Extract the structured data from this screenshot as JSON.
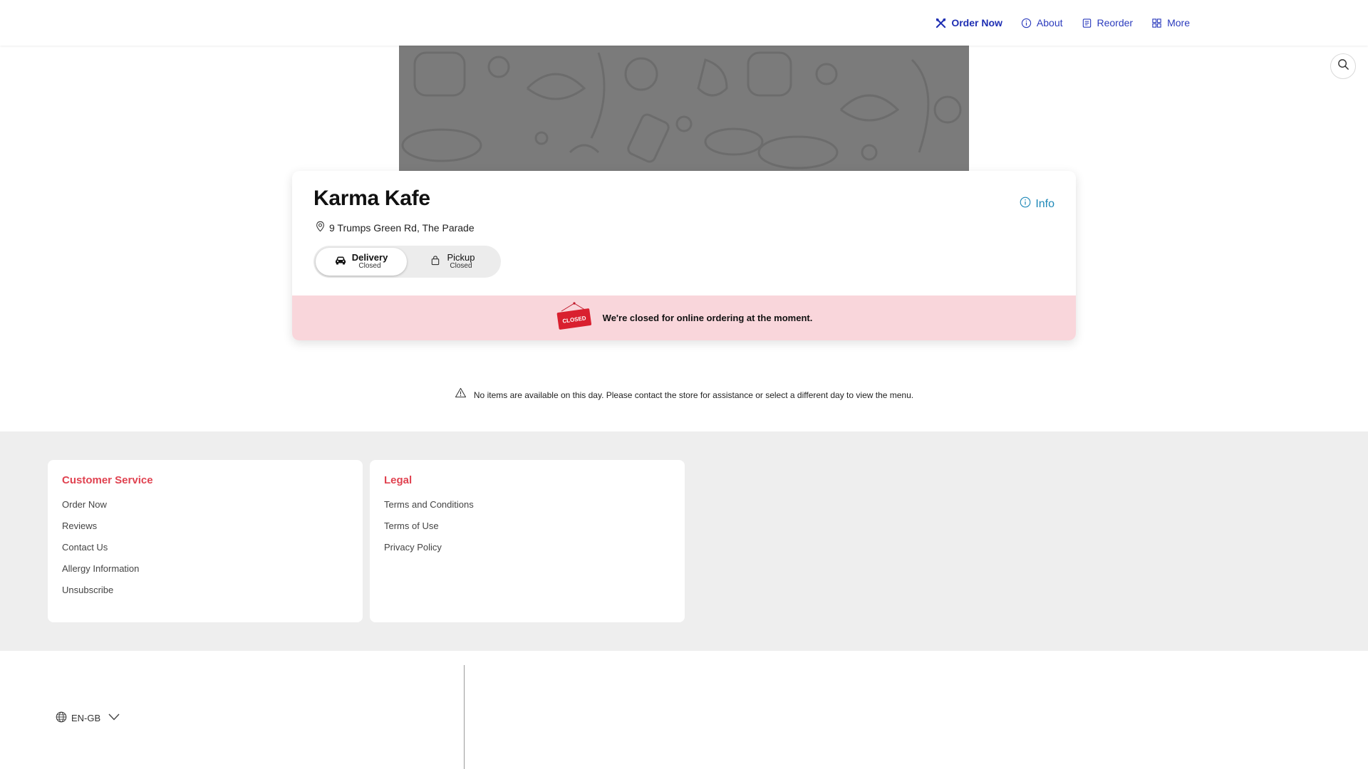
{
  "nav": {
    "items": [
      {
        "label": "Order Now",
        "icon": "utensils-icon",
        "active": true
      },
      {
        "label": "About",
        "icon": "info-icon"
      },
      {
        "label": "Reorder",
        "icon": "receipt-icon"
      },
      {
        "label": "More",
        "icon": "grid-icon"
      }
    ]
  },
  "store": {
    "name": "Karma Kafe",
    "address": "9 Trumps Green Rd, The Parade",
    "info_label": "Info"
  },
  "order_mode": {
    "delivery": {
      "label": "Delivery",
      "status": "Closed",
      "selected": true
    },
    "pickup": {
      "label": "Pickup",
      "status": "Closed",
      "selected": false
    }
  },
  "closed_banner": {
    "sign_text": "CLOSED",
    "message": "We're closed for online ordering at the moment."
  },
  "notice": "No items are available on this day. Please contact the store for assistance or select a different day to view the menu.",
  "footer": {
    "customer_service": {
      "title": "Customer Service",
      "links": [
        "Order Now",
        "Reviews",
        "Contact Us",
        "Allergy Information",
        "Unsubscribe"
      ]
    },
    "legal": {
      "title": "Legal",
      "links": [
        "Terms and Conditions",
        "Terms of Use",
        "Privacy Policy"
      ]
    }
  },
  "language": "EN-GB",
  "colors": {
    "nav_link": "#2b3bbd",
    "info_link": "#1e88b8",
    "footer_heading": "#e04250",
    "closed_strip": "#f9d6db",
    "banner_bg": "#7b7b7b"
  }
}
